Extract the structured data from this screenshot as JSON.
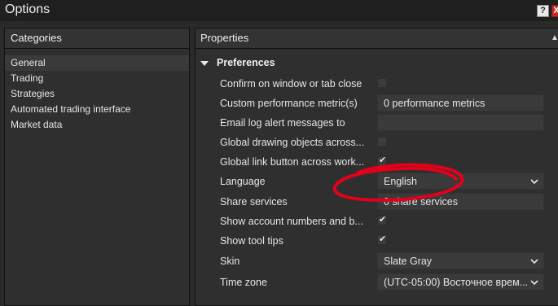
{
  "window": {
    "title": "Options",
    "help_label": "?",
    "close_label": "X"
  },
  "left_panel": {
    "header": "Categories",
    "items": [
      "General",
      "Trading",
      "Strategies",
      "Automated trading interface",
      "Market data"
    ]
  },
  "right_panel": {
    "header": "Properties",
    "section": "Preferences",
    "properties": [
      {
        "label": "Confirm on window or tab close",
        "type": "checkbox",
        "checked": false
      },
      {
        "label": "Custom performance metric(s)",
        "type": "text",
        "value": "0 performance metrics"
      },
      {
        "label": "Email log alert messages to",
        "type": "text",
        "value": ""
      },
      {
        "label": "Global drawing objects across...",
        "type": "checkbox",
        "checked": false
      },
      {
        "label": "Global link button across work...",
        "type": "checkbox",
        "checked": true
      },
      {
        "label": "Language",
        "type": "dropdown",
        "value": "English"
      },
      {
        "label": "Share services",
        "type": "text",
        "value": "0 share services"
      },
      {
        "label": "Show account numbers and b...",
        "type": "checkbox",
        "checked": true
      },
      {
        "label": "Show tool tips",
        "type": "checkbox",
        "checked": true
      },
      {
        "label": "Skin",
        "type": "dropdown",
        "value": "Slate Gray"
      },
      {
        "label": "Time zone",
        "type": "dropdown",
        "value": "(UTC-05:00) Восточное врем..."
      }
    ]
  },
  "colors": {
    "annotation": "#e3001b"
  }
}
